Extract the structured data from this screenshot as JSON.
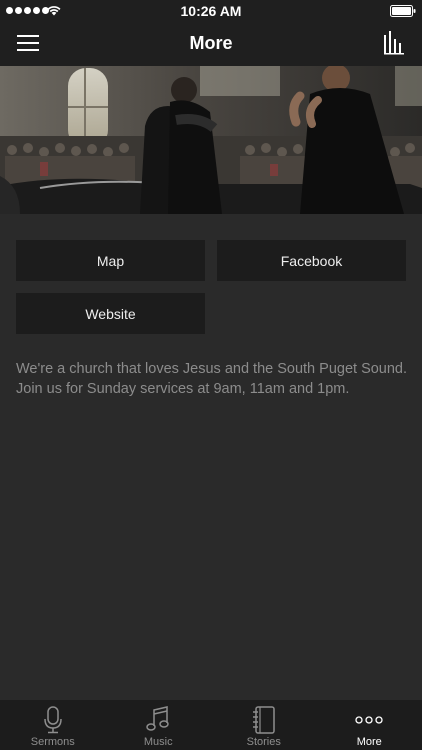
{
  "status_bar": {
    "time": "10:26 AM",
    "signal_dots": 5
  },
  "nav": {
    "title": "More",
    "left_icon": "hamburger-menu-icon",
    "right_icon": "audio-bars-icon"
  },
  "hero": {
    "image": "church-baptism-photo"
  },
  "buttons": {
    "map": "Map",
    "facebook": "Facebook",
    "website": "Website"
  },
  "description": "We're a church that loves Jesus and the South Puget Sound. Join us for Sunday services at 9am, 11am and 1pm.",
  "tabs": [
    {
      "label": "Sermons",
      "icon": "microphone-icon",
      "active": false
    },
    {
      "label": "Music",
      "icon": "music-note-icon",
      "active": false
    },
    {
      "label": "Stories",
      "icon": "notebook-icon",
      "active": false
    },
    {
      "label": "More",
      "icon": "more-dots-icon",
      "active": true
    }
  ],
  "colors": {
    "background": "#2a2a2a",
    "bar": "#1f1f1f",
    "button": "#1c1c1c",
    "text_muted": "#8c8c8c",
    "tab_active": "#ffffff",
    "tab_inactive": "#8e8e8e"
  }
}
